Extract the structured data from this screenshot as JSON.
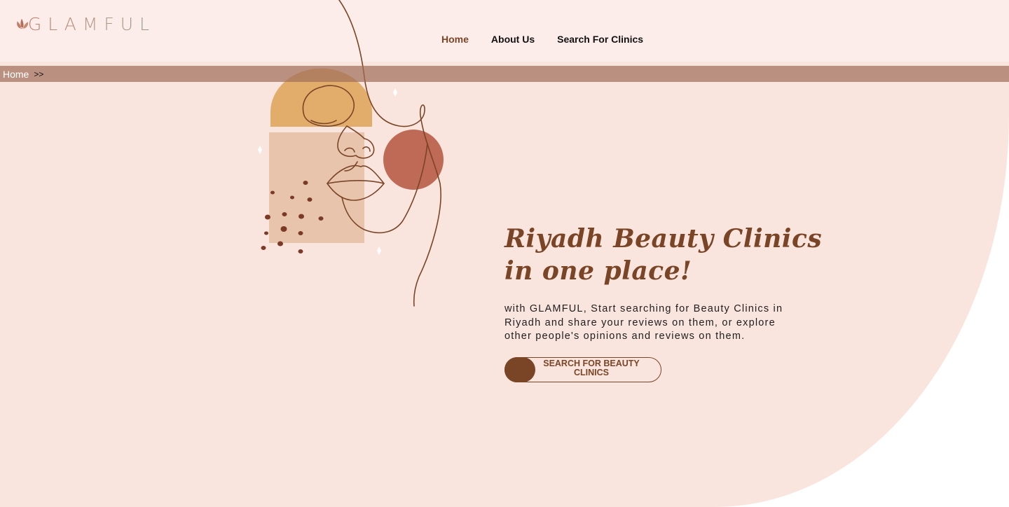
{
  "brand": {
    "name": "GLAMFUL",
    "accent": "#7a4526"
  },
  "nav": {
    "items": [
      {
        "label": "Home",
        "active": true
      },
      {
        "label": "About Us",
        "active": false
      },
      {
        "label": "Search For Clinics",
        "active": false
      }
    ]
  },
  "breadcrumb": {
    "home": "Home",
    "separator": ">>"
  },
  "hero": {
    "title_line1": "Riyadh Beauty Clinics",
    "title_line2": "in one place!",
    "description": "with GLAMFUL, Start searching for Beauty Clinics in Riyadh and share your reviews on them, or explore other people's opinions and reviews on them.",
    "cta_label": "SEARCH FOR BEAUTY CLINICS"
  },
  "colors": {
    "hero_bg": "#f9e5dd",
    "header_bg": "#fcedea",
    "breadcrumb_bg": "#b8968a",
    "orange_shape": "#e2ad6b",
    "terracotta_circle": "#bf6a56",
    "beige_square": "#e8c4ad"
  },
  "icons": [
    "leaf-logo-icon",
    "face-line-art-illustration"
  ]
}
